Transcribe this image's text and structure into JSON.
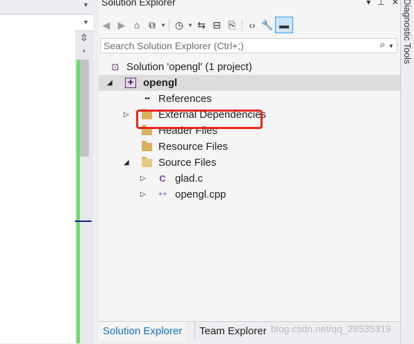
{
  "editor": {
    "split_icon": "⇳",
    "scroll_up_icon": "▲"
  },
  "explorer": {
    "title": "Solution Explorer",
    "title_controls": {
      "dropdown": "▾",
      "pin": "⊥",
      "close": "✕"
    },
    "toolbar": [
      {
        "name": "back-icon",
        "glyph": "◀"
      },
      {
        "name": "forward-icon",
        "glyph": "▶"
      },
      {
        "name": "home-icon",
        "glyph": "⌂"
      },
      {
        "name": "switch-views-icon",
        "glyph": "⧉"
      },
      {
        "name": "pending-changes-filter-icon",
        "glyph": "◷"
      },
      {
        "name": "sync-icon",
        "glyph": "⇆"
      },
      {
        "name": "collapse-all-icon",
        "glyph": "⊟"
      },
      {
        "name": "show-all-files-icon",
        "glyph": "⎘"
      },
      {
        "name": "view-code-icon",
        "glyph": "‹›"
      },
      {
        "name": "properties-icon",
        "glyph": "🔧"
      },
      {
        "name": "preview-selected-icon",
        "glyph": "▬"
      }
    ],
    "search": {
      "placeholder": "Search Solution Explorer (Ctrl+;)"
    },
    "tree": {
      "solution": "Solution 'opengl' (1 project)",
      "project": "opengl",
      "references": "References",
      "external_deps": "External Dependencies",
      "header_files": "Header Files",
      "resource_files": "Resource Files",
      "source_files": "Source Files",
      "file_c": "glad.c",
      "file_cpp": "opengl.cpp"
    },
    "bottom_tabs": {
      "active": "Solution Explorer",
      "inactive": "Team Explorer"
    },
    "watermark": "blog.csdn.net/qq_28535319"
  },
  "side_panel": {
    "label": "Diagnostic Tools"
  },
  "colors": {
    "accent": "#0e70c0",
    "highlight_box": "#e8231f",
    "selection": "#dcdcdc"
  }
}
